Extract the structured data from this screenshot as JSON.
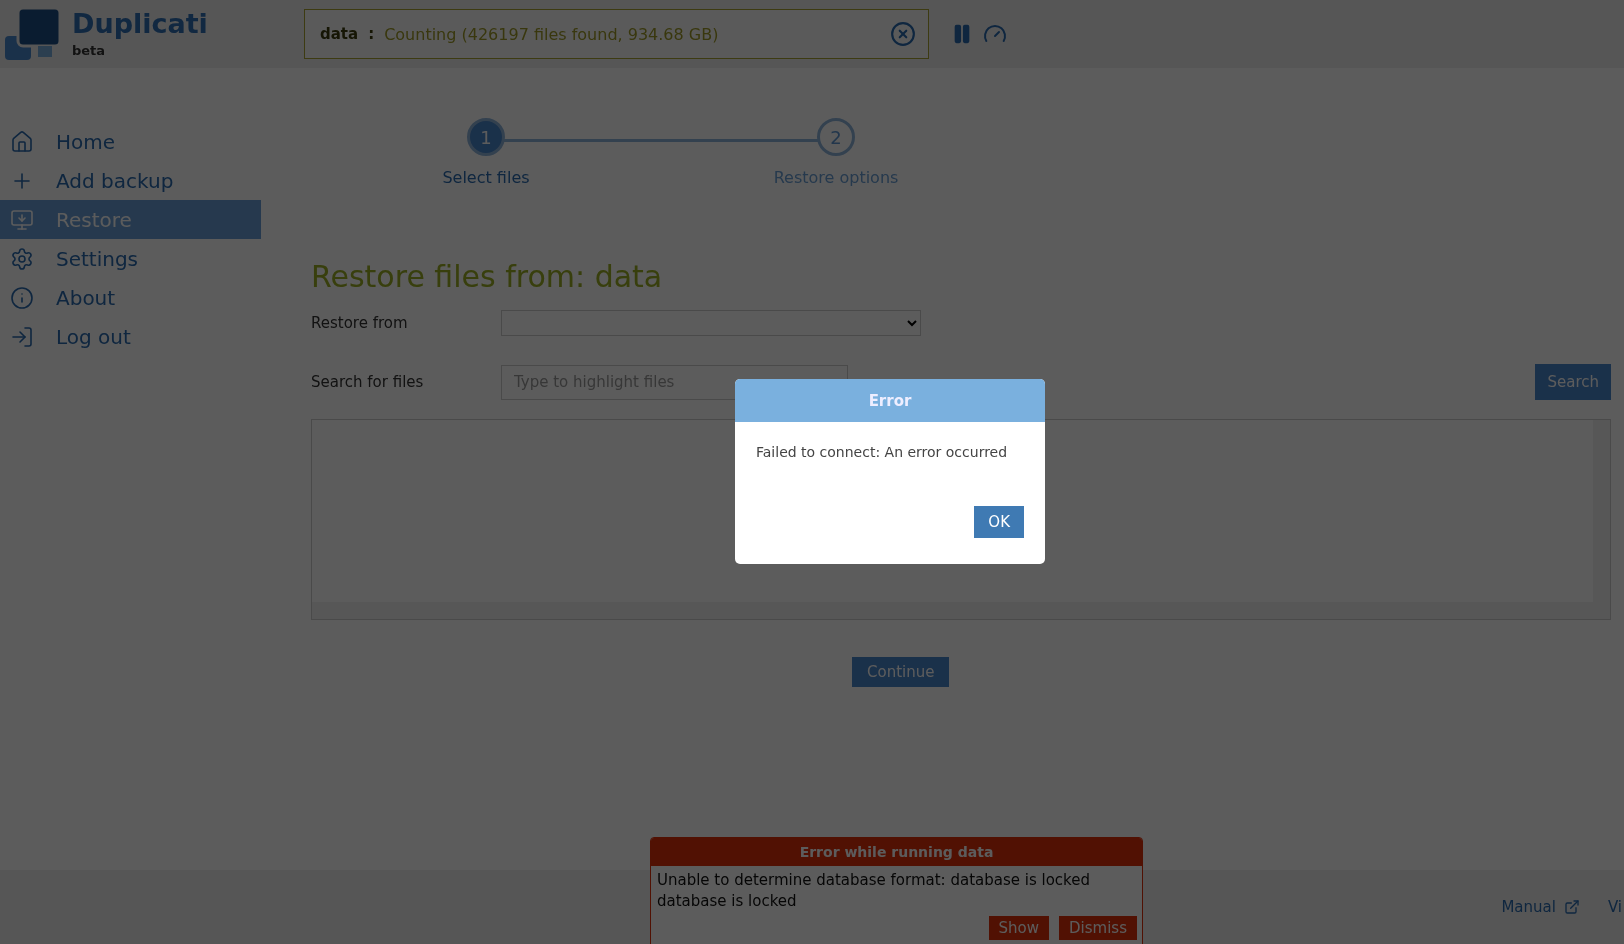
{
  "app": {
    "name": "Duplicati",
    "tag": "beta"
  },
  "status": {
    "backup": "data",
    "separator": ":",
    "message": "Counting (426197 files found, 934.68 GB)"
  },
  "sidebar": {
    "items": [
      {
        "label": "Home",
        "selected": false
      },
      {
        "label": "Add backup",
        "selected": false
      },
      {
        "label": "Restore",
        "selected": true
      },
      {
        "label": "Settings",
        "selected": false
      },
      {
        "label": "About",
        "selected": false
      },
      {
        "label": "Log out",
        "selected": false
      }
    ]
  },
  "stepper": [
    {
      "number": "1",
      "label": "Select files",
      "selected": true
    },
    {
      "number": "2",
      "label": "Restore options",
      "selected": false
    }
  ],
  "page_title": "Restore files from: data",
  "restore_from": {
    "label": "Restore from"
  },
  "search": {
    "label": "Search for files",
    "placeholder": "Type to highlight files",
    "button": "Search"
  },
  "continue_button": "Continue",
  "dialog": {
    "title": "Error",
    "message": "Failed to connect: An error occurred",
    "button": "OK"
  },
  "toast": {
    "title": "Error while running data",
    "message": "Unable to determine database format: database is locked database is locked",
    "buttons": [
      "Show",
      "Dismiss"
    ]
  },
  "footer": {
    "links": [
      {
        "label": "Manual",
        "external": true
      },
      {
        "label": "Vi",
        "external": false
      }
    ]
  }
}
